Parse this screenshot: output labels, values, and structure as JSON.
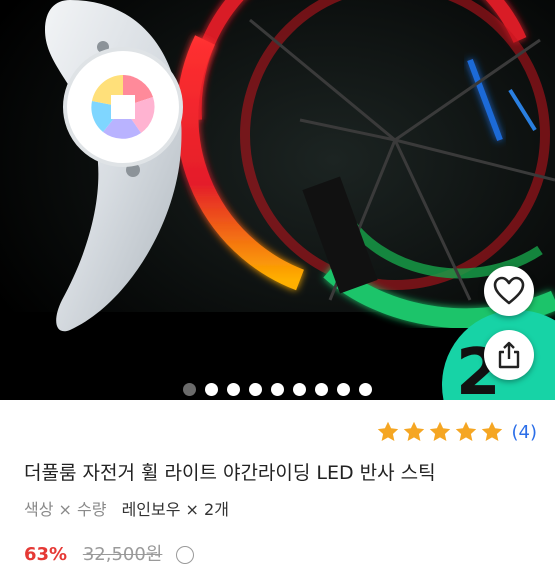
{
  "product": {
    "rating": {
      "stars": 5,
      "count_label": "(4)"
    },
    "title": "더풀룸 자전거 휠 라이트 야간라이딩 LED 반사 스틱",
    "options": {
      "label": "색상 × 수량",
      "value": "레인보우 × 2개"
    },
    "price": {
      "discount": "63%",
      "original": "32,500원"
    },
    "badge_text": "2",
    "carousel": {
      "total": 9,
      "active_index": 0
    }
  },
  "icons": {
    "favorite": "heart-icon",
    "share": "share-icon",
    "price_info": "info-icon",
    "star": "star-icon"
  },
  "colors": {
    "star": "#f5a623",
    "rating_count": "#2b6ee8",
    "discount": "#e53935",
    "badge": "#17d3a6"
  }
}
